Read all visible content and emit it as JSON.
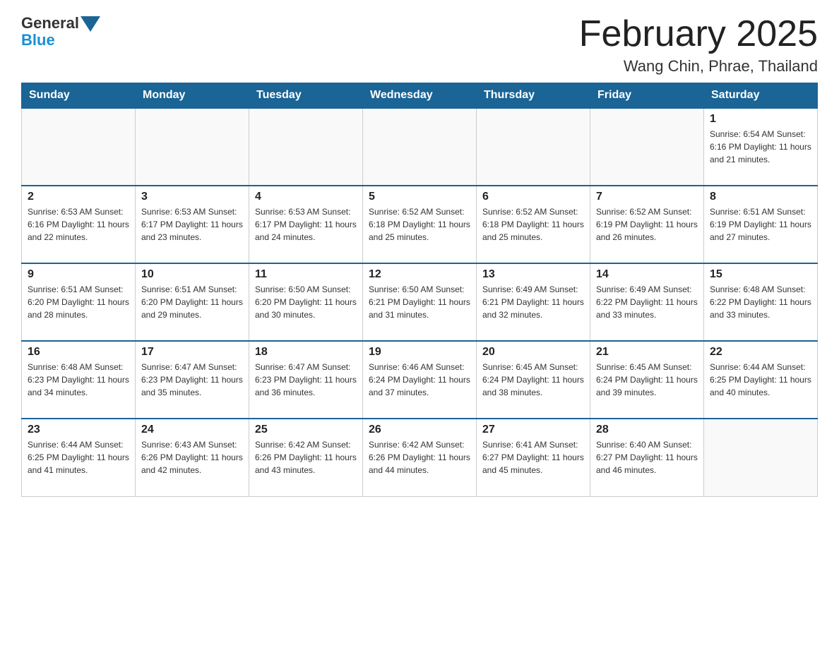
{
  "header": {
    "logo_general": "General",
    "logo_blue": "Blue",
    "month_title": "February 2025",
    "location": "Wang Chin, Phrae, Thailand"
  },
  "weekdays": [
    "Sunday",
    "Monday",
    "Tuesday",
    "Wednesday",
    "Thursday",
    "Friday",
    "Saturday"
  ],
  "weeks": [
    [
      {
        "day": "",
        "info": ""
      },
      {
        "day": "",
        "info": ""
      },
      {
        "day": "",
        "info": ""
      },
      {
        "day": "",
        "info": ""
      },
      {
        "day": "",
        "info": ""
      },
      {
        "day": "",
        "info": ""
      },
      {
        "day": "1",
        "info": "Sunrise: 6:54 AM\nSunset: 6:16 PM\nDaylight: 11 hours\nand 21 minutes."
      }
    ],
    [
      {
        "day": "2",
        "info": "Sunrise: 6:53 AM\nSunset: 6:16 PM\nDaylight: 11 hours\nand 22 minutes."
      },
      {
        "day": "3",
        "info": "Sunrise: 6:53 AM\nSunset: 6:17 PM\nDaylight: 11 hours\nand 23 minutes."
      },
      {
        "day": "4",
        "info": "Sunrise: 6:53 AM\nSunset: 6:17 PM\nDaylight: 11 hours\nand 24 minutes."
      },
      {
        "day": "5",
        "info": "Sunrise: 6:52 AM\nSunset: 6:18 PM\nDaylight: 11 hours\nand 25 minutes."
      },
      {
        "day": "6",
        "info": "Sunrise: 6:52 AM\nSunset: 6:18 PM\nDaylight: 11 hours\nand 25 minutes."
      },
      {
        "day": "7",
        "info": "Sunrise: 6:52 AM\nSunset: 6:19 PM\nDaylight: 11 hours\nand 26 minutes."
      },
      {
        "day": "8",
        "info": "Sunrise: 6:51 AM\nSunset: 6:19 PM\nDaylight: 11 hours\nand 27 minutes."
      }
    ],
    [
      {
        "day": "9",
        "info": "Sunrise: 6:51 AM\nSunset: 6:20 PM\nDaylight: 11 hours\nand 28 minutes."
      },
      {
        "day": "10",
        "info": "Sunrise: 6:51 AM\nSunset: 6:20 PM\nDaylight: 11 hours\nand 29 minutes."
      },
      {
        "day": "11",
        "info": "Sunrise: 6:50 AM\nSunset: 6:20 PM\nDaylight: 11 hours\nand 30 minutes."
      },
      {
        "day": "12",
        "info": "Sunrise: 6:50 AM\nSunset: 6:21 PM\nDaylight: 11 hours\nand 31 minutes."
      },
      {
        "day": "13",
        "info": "Sunrise: 6:49 AM\nSunset: 6:21 PM\nDaylight: 11 hours\nand 32 minutes."
      },
      {
        "day": "14",
        "info": "Sunrise: 6:49 AM\nSunset: 6:22 PM\nDaylight: 11 hours\nand 33 minutes."
      },
      {
        "day": "15",
        "info": "Sunrise: 6:48 AM\nSunset: 6:22 PM\nDaylight: 11 hours\nand 33 minutes."
      }
    ],
    [
      {
        "day": "16",
        "info": "Sunrise: 6:48 AM\nSunset: 6:23 PM\nDaylight: 11 hours\nand 34 minutes."
      },
      {
        "day": "17",
        "info": "Sunrise: 6:47 AM\nSunset: 6:23 PM\nDaylight: 11 hours\nand 35 minutes."
      },
      {
        "day": "18",
        "info": "Sunrise: 6:47 AM\nSunset: 6:23 PM\nDaylight: 11 hours\nand 36 minutes."
      },
      {
        "day": "19",
        "info": "Sunrise: 6:46 AM\nSunset: 6:24 PM\nDaylight: 11 hours\nand 37 minutes."
      },
      {
        "day": "20",
        "info": "Sunrise: 6:45 AM\nSunset: 6:24 PM\nDaylight: 11 hours\nand 38 minutes."
      },
      {
        "day": "21",
        "info": "Sunrise: 6:45 AM\nSunset: 6:24 PM\nDaylight: 11 hours\nand 39 minutes."
      },
      {
        "day": "22",
        "info": "Sunrise: 6:44 AM\nSunset: 6:25 PM\nDaylight: 11 hours\nand 40 minutes."
      }
    ],
    [
      {
        "day": "23",
        "info": "Sunrise: 6:44 AM\nSunset: 6:25 PM\nDaylight: 11 hours\nand 41 minutes."
      },
      {
        "day": "24",
        "info": "Sunrise: 6:43 AM\nSunset: 6:26 PM\nDaylight: 11 hours\nand 42 minutes."
      },
      {
        "day": "25",
        "info": "Sunrise: 6:42 AM\nSunset: 6:26 PM\nDaylight: 11 hours\nand 43 minutes."
      },
      {
        "day": "26",
        "info": "Sunrise: 6:42 AM\nSunset: 6:26 PM\nDaylight: 11 hours\nand 44 minutes."
      },
      {
        "day": "27",
        "info": "Sunrise: 6:41 AM\nSunset: 6:27 PM\nDaylight: 11 hours\nand 45 minutes."
      },
      {
        "day": "28",
        "info": "Sunrise: 6:40 AM\nSunset: 6:27 PM\nDaylight: 11 hours\nand 46 minutes."
      },
      {
        "day": "",
        "info": ""
      }
    ]
  ]
}
